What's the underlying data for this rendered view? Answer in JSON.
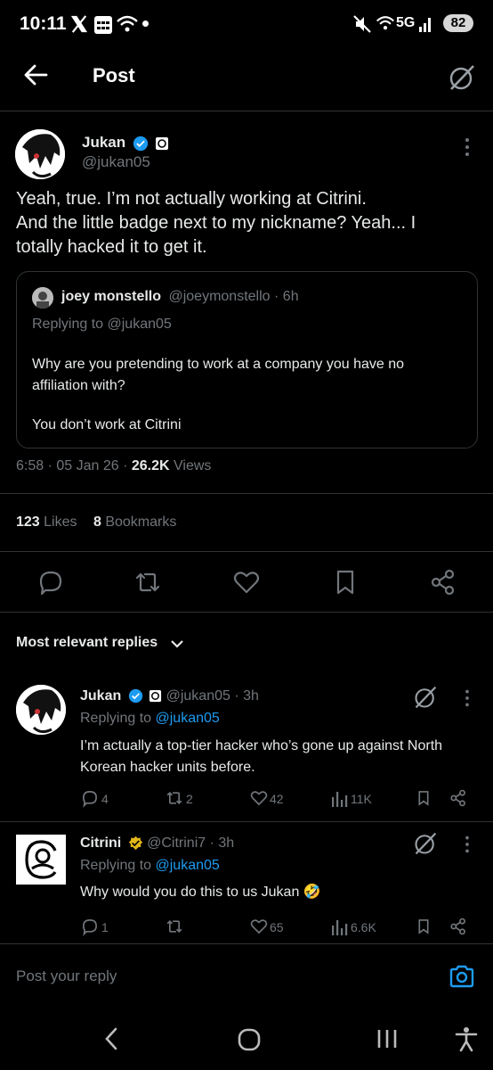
{
  "status_bar": {
    "time": "10:11",
    "network": "5G",
    "battery": "82"
  },
  "header": {
    "title": "Post"
  },
  "post": {
    "author_name": "Jukan",
    "author_handle": "@jukan05",
    "text_line1": "Yeah, true. I’m not actually working at Citrini.",
    "text_line2": "And the little badge next to my nickname? Yeah... I",
    "text_line3": "totally hacked it to get it.",
    "quote": {
      "author_name": "joey monstello",
      "author_handle": "@joeymonstello",
      "time": "· 6h",
      "replying_to": "Replying to @jukan05",
      "text_line1": "Why are you pretending to work at a company you have no",
      "text_line2": "affiliation with?",
      "text_line3": "You don’t work at Citrini"
    },
    "timestamp": "6:58 · 05 Jan 26 ·",
    "views_count": "26.2K",
    "views_label": "Views",
    "likes_count": "123",
    "likes_label": "Likes",
    "bookmarks_count": "8",
    "bookmarks_label": "Bookmarks"
  },
  "replies_header": {
    "label": "Most relevant replies"
  },
  "replies": [
    {
      "author_name": "Jukan",
      "author_handle": "@jukan05",
      "time": "· 3h",
      "replying_prefix": "Replying to",
      "replying_handle": "@jukan05",
      "text_line1": "I’m actually a top-tier hacker who’s gone up against North",
      "text_line2": "Korean hacker units before.",
      "replies": "4",
      "reposts": "2",
      "likes": "42",
      "views": "11K"
    },
    {
      "author_name": "Citrini",
      "author_handle": "@Citrini7",
      "time": "· 3h",
      "replying_prefix": "Replying to",
      "replying_handle": "@jukan05",
      "text_line1": "Why would you do this to us Jukan 🤣",
      "replies": "1",
      "reposts": "",
      "likes": "65",
      "views": "6.6K"
    }
  ],
  "reply_box": {
    "placeholder": "Post your reply"
  },
  "colors": {
    "background": "#000000",
    "text": "#e7e9ea",
    "muted": "#71767b",
    "accent": "#1d9bf0",
    "gold": "#e2b719",
    "divider": "#2f3336"
  },
  "icons": [
    "x-logo-icon",
    "calendar-icon",
    "wifi-icon",
    "mute-icon",
    "signal-icon",
    "back-arrow-icon",
    "grok-icon",
    "verified-badge-icon",
    "more-icon",
    "reply-icon",
    "repost-icon",
    "like-icon",
    "bookmark-icon",
    "share-icon",
    "views-icon",
    "chevron-down-icon",
    "camera-icon",
    "nav-back-icon",
    "nav-home-icon",
    "nav-recents-icon",
    "accessibility-icon"
  ]
}
